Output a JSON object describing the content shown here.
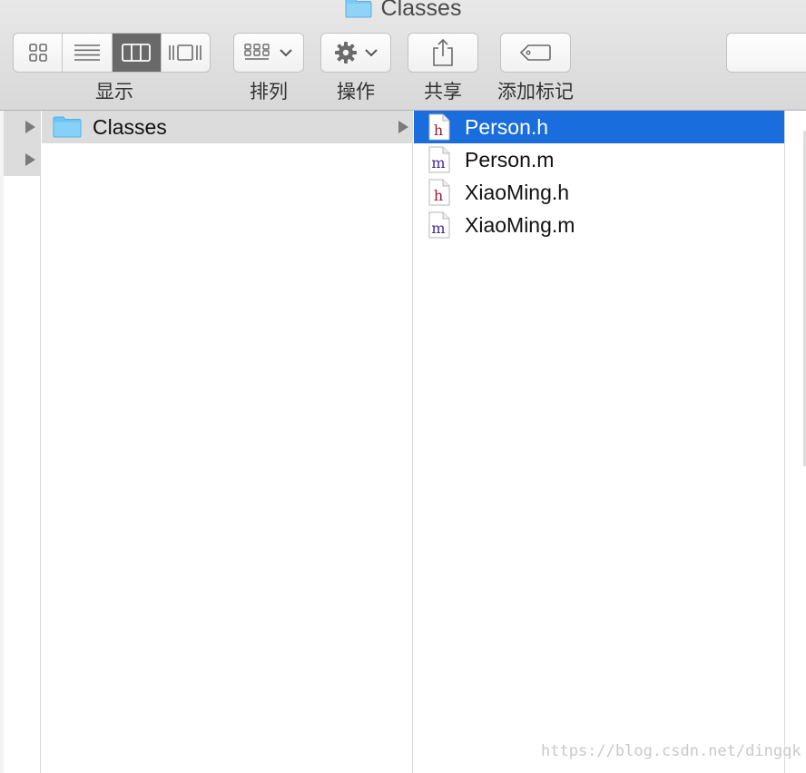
{
  "window": {
    "title": "Classes",
    "icons": {
      "title": "folder-icon"
    }
  },
  "toolbar": {
    "view_label": "显示",
    "view_modes": [
      "icon-view",
      "list-view",
      "column-view",
      "cover-flow-view"
    ],
    "view_selected": "column-view",
    "arrange_label": "排列",
    "action_label": "操作",
    "share_label": "共享",
    "tags_label": "添加标记"
  },
  "browser": {
    "column1": {
      "items": [
        {
          "name": "Classes",
          "icon": "folder-icon",
          "expandable": true,
          "selected": true
        }
      ]
    },
    "column2": {
      "items": [
        {
          "name": "Person.h",
          "icon": "header-file-icon",
          "glyph": "h",
          "selected": true
        },
        {
          "name": "Person.m",
          "icon": "objc-file-icon",
          "glyph": "m",
          "selected": false
        },
        {
          "name": "XiaoMing.h",
          "icon": "header-file-icon",
          "glyph": "h",
          "selected": false
        },
        {
          "name": "XiaoMing.m",
          "icon": "objc-file-icon",
          "glyph": "m",
          "selected": false
        }
      ]
    }
  },
  "colors": {
    "selection_blue": "#1a6ddc",
    "selection_grey": "#dcdcdc",
    "folder_blue": "#6cc4f5",
    "header_glyph": "#9b1b30",
    "impl_glyph": "#3f2a8a"
  },
  "watermark": "https://blog.csdn.net/dingqk"
}
